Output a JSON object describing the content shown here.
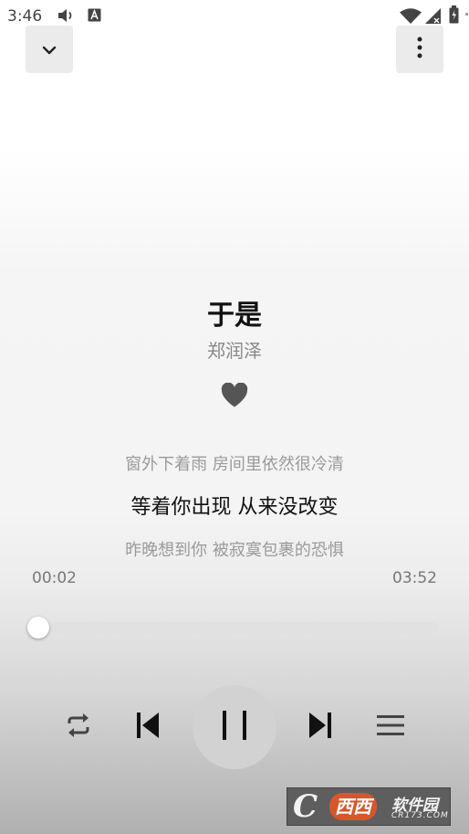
{
  "status_bar": {
    "time": "3:46",
    "icons": [
      "volume-icon",
      "a-notification-icon",
      "wifi-icon",
      "signal-icon",
      "battery-icon"
    ]
  },
  "header": {
    "back_icon": "chevron-down-icon",
    "more_icon": "more-vertical-icon"
  },
  "song": {
    "title": "于是",
    "artist": "郑润泽",
    "favorite_icon": "heart-icon"
  },
  "lyrics": {
    "previous": "窗外下着雨 房间里依然很冷清",
    "current": "等着你出现 从来没改变",
    "next": "昨晚想到你 被寂寞包裹的恐惧"
  },
  "playback": {
    "current_time": "00:02",
    "total_time": "03:52",
    "progress_fraction": 0.009
  },
  "controls": {
    "repeat_icon": "repeat-icon",
    "previous_icon": "skip-previous-icon",
    "play_pause_icon": "pause-icon",
    "next_icon": "skip-next-icon",
    "playlist_icon": "playlist-icon"
  },
  "watermark": {
    "logo": "C",
    "brand": "西西",
    "text": "软件园",
    "domain": "CR173.COM"
  },
  "colors": {
    "title": "#111111",
    "secondary_text": "#888888",
    "heart": "#555555",
    "play_button_bg": "#d2d2d2",
    "watermark_accent": "#d6572a"
  }
}
